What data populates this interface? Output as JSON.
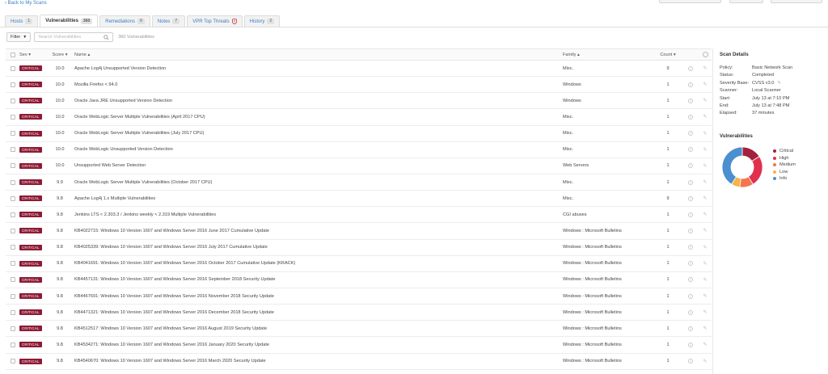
{
  "nav": {
    "back_label": "Back to My Scans"
  },
  "tabs": [
    {
      "label": "Hosts",
      "count": "1",
      "active": false
    },
    {
      "label": "Vulnerabilities",
      "count": "360",
      "active": true
    },
    {
      "label": "Remediations",
      "count": "9",
      "active": false
    },
    {
      "label": "Notes",
      "count": "7",
      "active": false
    },
    {
      "label": "VPR Top Threats",
      "count": "",
      "active": false
    },
    {
      "label": "History",
      "count": "2",
      "active": false
    }
  ],
  "toolbar": {
    "filter_label": "Filter",
    "search_placeholder": "Search Vulnerabilities",
    "result_count": "360 Vulnerabilities"
  },
  "table": {
    "headers": {
      "sev": "Sev",
      "score": "Score",
      "name": "Name",
      "family": "Family",
      "count": "Count"
    },
    "sort_down": "▾",
    "sort_up": "▴",
    "rows": [
      {
        "sev": "CRITICAL",
        "score": "10.0",
        "name": "Apache Log4j Unsupported Version Detection",
        "family": "Misc.",
        "count": "9"
      },
      {
        "sev": "CRITICAL",
        "score": "10.0",
        "name": "Mozilla Firefox < 94.0",
        "family": "Windows",
        "count": "1"
      },
      {
        "sev": "CRITICAL",
        "score": "10.0",
        "name": "Oracle Java JRE Unsupported Version Detection",
        "family": "Windows",
        "count": "1"
      },
      {
        "sev": "CRITICAL",
        "score": "10.0",
        "name": "Oracle WebLogic Server Multiple Vulnerabilities (April 2017 CPU)",
        "family": "Misc.",
        "count": "1"
      },
      {
        "sev": "CRITICAL",
        "score": "10.0",
        "name": "Oracle WebLogic Server Multiple Vulnerabilities (July 2017 CPU)",
        "family": "Misc.",
        "count": "1"
      },
      {
        "sev": "CRITICAL",
        "score": "10.0",
        "name": "Oracle WebLogic Unsupported Version Detection",
        "family": "Misc.",
        "count": "1"
      },
      {
        "sev": "CRITICAL",
        "score": "10.0",
        "name": "Unsupported Web Server Detection",
        "family": "Web Servers",
        "count": "1"
      },
      {
        "sev": "CRITICAL",
        "score": "9.9",
        "name": "Oracle WebLogic Server Multiple Vulnerabilities (October 2017 CPU)",
        "family": "Misc.",
        "count": "1"
      },
      {
        "sev": "CRITICAL",
        "score": "9.8",
        "name": "Apache Log4j 1.x Multiple Vulnerabilities",
        "family": "Misc.",
        "count": "9"
      },
      {
        "sev": "CRITICAL",
        "score": "9.8",
        "name": "Jenkins LTS < 2.303.3 / Jenkins weekly < 2.319 Multiple Vulnerabilities",
        "family": "CGI abuses",
        "count": "1"
      },
      {
        "sev": "CRITICAL",
        "score": "9.8",
        "name": "KB4022715: Windows 10 Version 1607 and Windows Server 2016 June 2017 Cumulative Update",
        "family": "Windows : Microsoft Bulletins",
        "count": "1"
      },
      {
        "sev": "CRITICAL",
        "score": "9.8",
        "name": "KB4025339: Windows 10 Version 1607 and Windows Server 2016 July 2017 Cumulative Update",
        "family": "Windows : Microsoft Bulletins",
        "count": "1"
      },
      {
        "sev": "CRITICAL",
        "score": "9.8",
        "name": "KB4041691: Windows 10 Version 1607 and Windows Server 2016 October 2017 Cumulative Update (KRACK)",
        "family": "Windows : Microsoft Bulletins",
        "count": "1"
      },
      {
        "sev": "CRITICAL",
        "score": "9.8",
        "name": "KB4457131: Windows 10 Version 1607 and Windows Server 2016 September 2018 Security Update",
        "family": "Windows : Microsoft Bulletins",
        "count": "1"
      },
      {
        "sev": "CRITICAL",
        "score": "9.8",
        "name": "KB4467691: Windows 10 Version 1607 and Windows Server 2016 November 2018 Security Update",
        "family": "Windows : Microsoft Bulletins",
        "count": "1"
      },
      {
        "sev": "CRITICAL",
        "score": "9.8",
        "name": "KB4471321: Windows 10 Version 1607 and Windows Server 2016 December 2018 Security Update",
        "family": "Windows : Microsoft Bulletins",
        "count": "1"
      },
      {
        "sev": "CRITICAL",
        "score": "9.8",
        "name": "KB4512517: Windows 10 Version 1607 and Windows Server 2016 August 2019 Security Update",
        "family": "Windows : Microsoft Bulletins",
        "count": "1"
      },
      {
        "sev": "CRITICAL",
        "score": "9.8",
        "name": "KB4534271: Windows 10 Version 1607 and Windows Server 2016 January 2020 Security Update",
        "family": "Windows : Microsoft Bulletins",
        "count": "1"
      },
      {
        "sev": "CRITICAL",
        "score": "9.8",
        "name": "KB4540670: Windows 10 Version 1607 and Windows Server 2016 March 2020 Security Update",
        "family": "Windows : Microsoft Bulletins",
        "count": "1"
      }
    ]
  },
  "scan_details": {
    "title": "Scan Details",
    "fields": [
      {
        "key": "Policy:",
        "value": "Basic Network Scan"
      },
      {
        "key": "Status:",
        "value": "Completed"
      },
      {
        "key": "Severity Base:",
        "value": "CVSS v3.0"
      },
      {
        "key": "Scanner:",
        "value": "Local Scanner"
      },
      {
        "key": "Start:",
        "value": "July 13 at 7:10 PM"
      },
      {
        "key": "End:",
        "value": "July 13 at 7:48 PM"
      },
      {
        "key": "Elapsed:",
        "value": "37 minutes"
      }
    ]
  },
  "vuln_chart": {
    "title": "Vulnerabilities",
    "segments": [
      {
        "label": "Critical",
        "color": "#a3213c",
        "share": 0.16
      },
      {
        "label": "High",
        "color": "#e0304d",
        "share": 0.25
      },
      {
        "label": "Medium",
        "color": "#f3764e",
        "share": 0.11
      },
      {
        "label": "Low",
        "color": "#f6b34a",
        "share": 0.07
      },
      {
        "label": "Info",
        "color": "#4a8fcf",
        "share": 0.41
      }
    ]
  },
  "colors": {
    "accent": "#3a7fc1",
    "critical_badge": "#8e1a33"
  }
}
